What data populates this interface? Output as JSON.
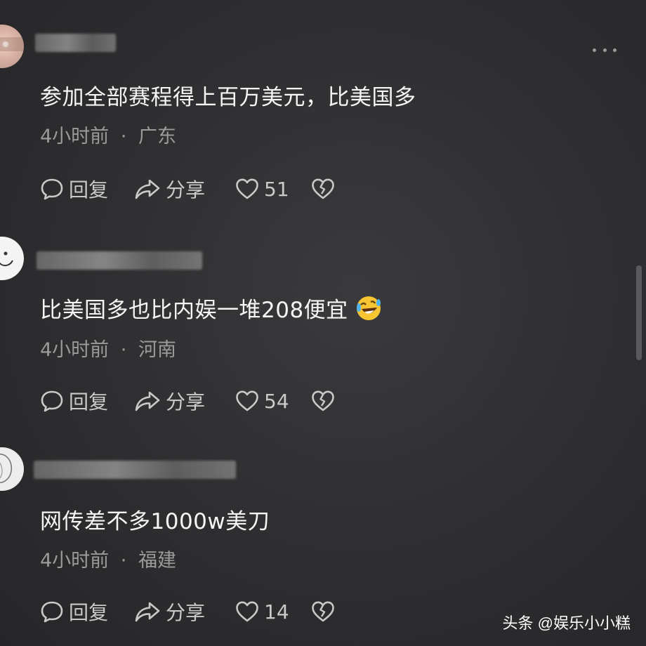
{
  "comments": [
    {
      "text": "参加全部赛程得上百万美元，比美国多",
      "time": "4小时前",
      "location": "广东",
      "reply_label": "回复",
      "share_label": "分享",
      "likes": "51"
    },
    {
      "text": "比美国多也比内娱一堆208便宜",
      "time": "4小时前",
      "location": "河南",
      "reply_label": "回复",
      "share_label": "分享",
      "likes": "54",
      "emoji": "rolling-on-floor-laughing-emoji"
    },
    {
      "text": "网传差不多1000w美刀",
      "time": "4小时前",
      "location": "福建",
      "reply_label": "回复",
      "share_label": "分享",
      "likes": "14"
    }
  ],
  "meta_separator": "·",
  "watermark": "头条 @娱乐小小糕",
  "icons": {
    "reply": "speech-bubble-icon",
    "share": "share-arrow-icon",
    "like": "heart-icon",
    "dislike": "broken-heart-icon",
    "more": "more-dots-icon"
  }
}
